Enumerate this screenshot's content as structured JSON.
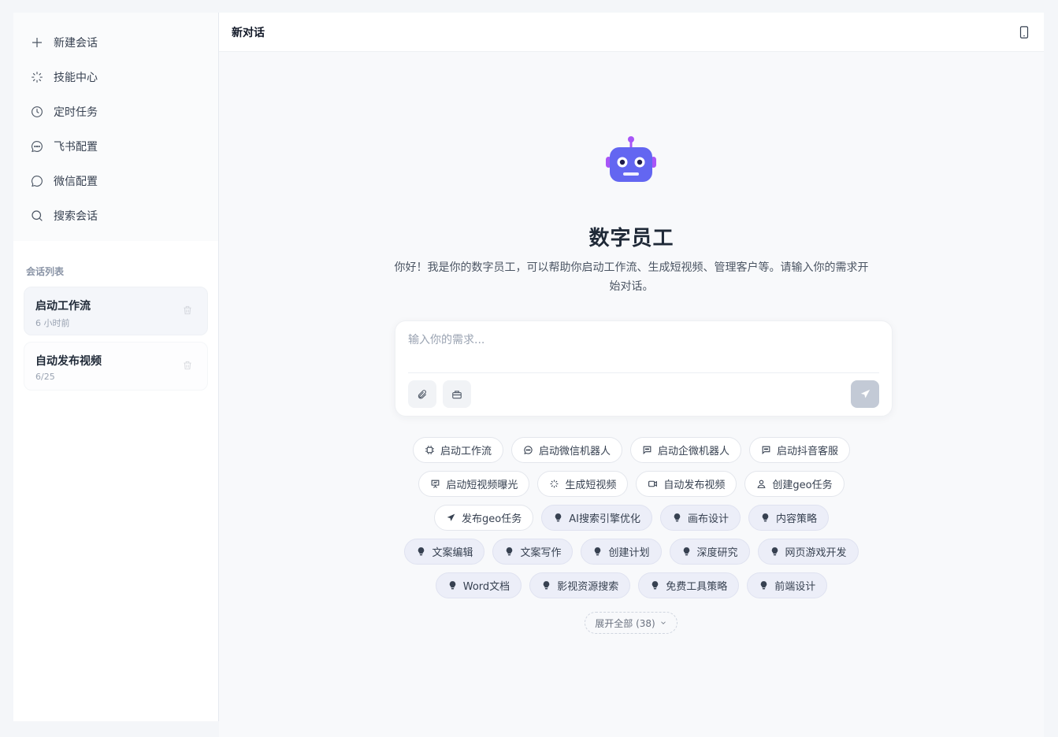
{
  "sidebar": {
    "nav": [
      {
        "label": "新建会话",
        "icon": "plus-icon"
      },
      {
        "label": "技能中心",
        "icon": "sparkle-icon"
      },
      {
        "label": "定时任务",
        "icon": "clock-icon"
      },
      {
        "label": "飞书配置",
        "icon": "chat-dots-icon"
      },
      {
        "label": "微信配置",
        "icon": "chat-bubble-icon"
      },
      {
        "label": "搜索会话",
        "icon": "search-icon"
      }
    ],
    "section_label": "会话列表",
    "conversations": [
      {
        "title": "启动工作流",
        "time": "6 小时前"
      },
      {
        "title": "自动发布视频",
        "time": "6/25"
      }
    ]
  },
  "header": {
    "title": "新对话"
  },
  "hero": {
    "title": "数字员工",
    "subtitle": "你好！我是你的数字员工，可以帮助你启动工作流、生成短视频、管理客户等。请输入你的需求开始对话。"
  },
  "composer": {
    "placeholder": "输入你的需求..."
  },
  "chips": [
    [
      {
        "label": "启动工作流",
        "icon": "cpu-icon",
        "style": "outline"
      },
      {
        "label": "启动微信机器人",
        "icon": "chat-dots-icon",
        "style": "outline"
      },
      {
        "label": "启动企微机器人",
        "icon": "message-square-icon",
        "style": "outline"
      },
      {
        "label": "启动抖音客服",
        "icon": "message-square-icon",
        "style": "outline"
      }
    ],
    [
      {
        "label": "启动短视频曝光",
        "icon": "presentation-icon",
        "style": "outline"
      },
      {
        "label": "生成短视频",
        "icon": "sparkle-icon",
        "style": "outline"
      },
      {
        "label": "自动发布视频",
        "icon": "video-icon",
        "style": "outline"
      },
      {
        "label": "创建geo任务",
        "icon": "user-icon",
        "style": "outline"
      }
    ],
    [
      {
        "label": "发布geo任务",
        "icon": "send-icon",
        "style": "outline"
      },
      {
        "label": "AI搜索引擎优化",
        "icon": "bulb-icon",
        "style": "filled"
      },
      {
        "label": "画布设计",
        "icon": "bulb-icon",
        "style": "filled"
      },
      {
        "label": "内容策略",
        "icon": "bulb-icon",
        "style": "filled"
      }
    ],
    [
      {
        "label": "文案编辑",
        "icon": "bulb-icon",
        "style": "filled"
      },
      {
        "label": "文案写作",
        "icon": "bulb-icon",
        "style": "filled"
      },
      {
        "label": "创建计划",
        "icon": "bulb-icon",
        "style": "filled"
      },
      {
        "label": "深度研究",
        "icon": "bulb-icon",
        "style": "filled"
      },
      {
        "label": "网页游戏开发",
        "icon": "bulb-icon",
        "style": "filled"
      }
    ],
    [
      {
        "label": "Word文档",
        "icon": "bulb-icon",
        "style": "filled"
      },
      {
        "label": "影视资源搜索",
        "icon": "bulb-icon",
        "style": "filled"
      },
      {
        "label": "免费工具策略",
        "icon": "bulb-icon",
        "style": "filled"
      },
      {
        "label": "前端设计",
        "icon": "bulb-icon",
        "style": "filled"
      }
    ]
  ],
  "expand_label": "展开全部 (38)",
  "colors": {
    "accent": "#6366f1",
    "robot": "#6366f1",
    "robot_antenna": "#a855f7",
    "send_disabled": "#c3cad6"
  }
}
